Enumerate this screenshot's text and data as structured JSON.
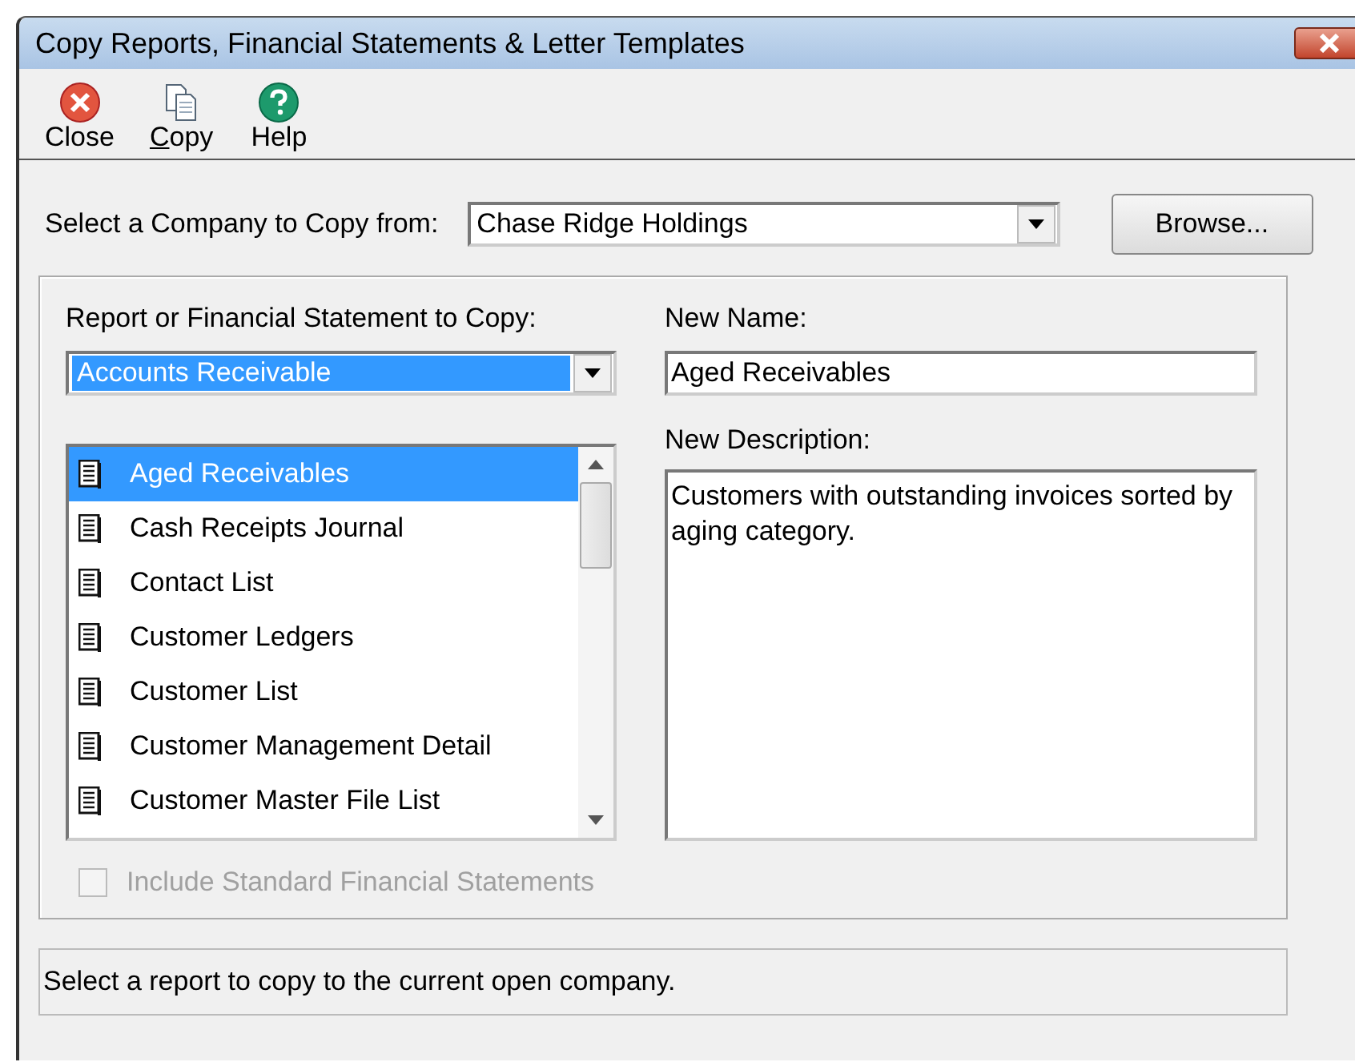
{
  "window": {
    "title": "Copy Reports, Financial Statements & Letter Templates"
  },
  "toolbar": [
    {
      "kind": "close",
      "label": "Close",
      "underlined": false
    },
    {
      "kind": "copy",
      "label": "Copy",
      "underlined": true
    },
    {
      "kind": "help",
      "label": "Help",
      "underlined": false
    }
  ],
  "company": {
    "label": "Select a Company to Copy from:",
    "value": "Chase Ridge Holdings",
    "browse": "Browse..."
  },
  "category": {
    "label": "Report or Financial Statement to Copy:",
    "value": "Accounts Receivable"
  },
  "reports": [
    {
      "name": "Aged Receivables",
      "selected": true
    },
    {
      "name": "Cash Receipts Journal",
      "selected": false
    },
    {
      "name": "Contact List",
      "selected": false
    },
    {
      "name": "Customer Ledgers",
      "selected": false
    },
    {
      "name": "Customer List",
      "selected": false
    },
    {
      "name": "Customer Management Detail",
      "selected": false
    },
    {
      "name": "Customer Master File List",
      "selected": false
    }
  ],
  "new_name": {
    "label": "New Name:",
    "value": "Aged Receivables"
  },
  "new_description": {
    "label": "New Description:",
    "value": "Customers with outstanding invoices sorted by aging category."
  },
  "include_standard": {
    "label": "Include Standard Financial Statements",
    "checked": false,
    "disabled": true
  },
  "status_bar": "Select a report to copy to the current open company."
}
